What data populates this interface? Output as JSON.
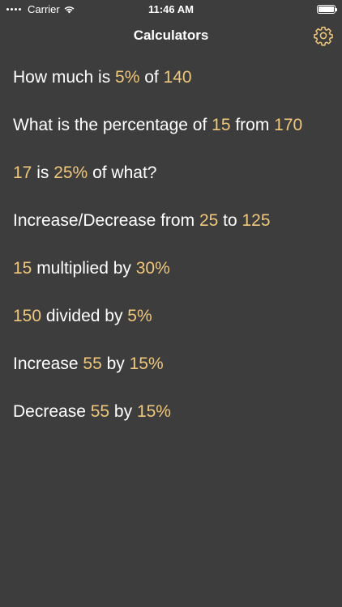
{
  "status_bar": {
    "carrier": "Carrier",
    "time": "11:46 AM",
    "battery_level": 1.0
  },
  "nav": {
    "title": "Calculators",
    "settings_icon": "gear-icon"
  },
  "colors": {
    "background": "#3d3d3d",
    "text": "#ffffff",
    "accent": "#f0c77b"
  },
  "calculators": [
    {
      "parts": [
        {
          "t": "How much is "
        },
        {
          "v": "5%"
        },
        {
          "t": " of "
        },
        {
          "v": "140"
        }
      ]
    },
    {
      "parts": [
        {
          "t": "What is the percentage of "
        },
        {
          "v": "15"
        },
        {
          "t": " from "
        },
        {
          "v": "170"
        }
      ]
    },
    {
      "parts": [
        {
          "v": "17"
        },
        {
          "t": " is "
        },
        {
          "v": "25%"
        },
        {
          "t": " of what?"
        }
      ]
    },
    {
      "parts": [
        {
          "t": "Increase/Decrease from "
        },
        {
          "v": "25"
        },
        {
          "t": " to "
        },
        {
          "v": "125"
        }
      ]
    },
    {
      "parts": [
        {
          "v": "15"
        },
        {
          "t": " multiplied by "
        },
        {
          "v": "30%"
        }
      ]
    },
    {
      "parts": [
        {
          "v": "150"
        },
        {
          "t": " divided by "
        },
        {
          "v": "5%"
        }
      ]
    },
    {
      "parts": [
        {
          "t": "Increase "
        },
        {
          "v": "55"
        },
        {
          "t": " by "
        },
        {
          "v": "15%"
        }
      ]
    },
    {
      "parts": [
        {
          "t": "Decrease "
        },
        {
          "v": "55"
        },
        {
          "t": " by "
        },
        {
          "v": "15%"
        }
      ]
    }
  ]
}
